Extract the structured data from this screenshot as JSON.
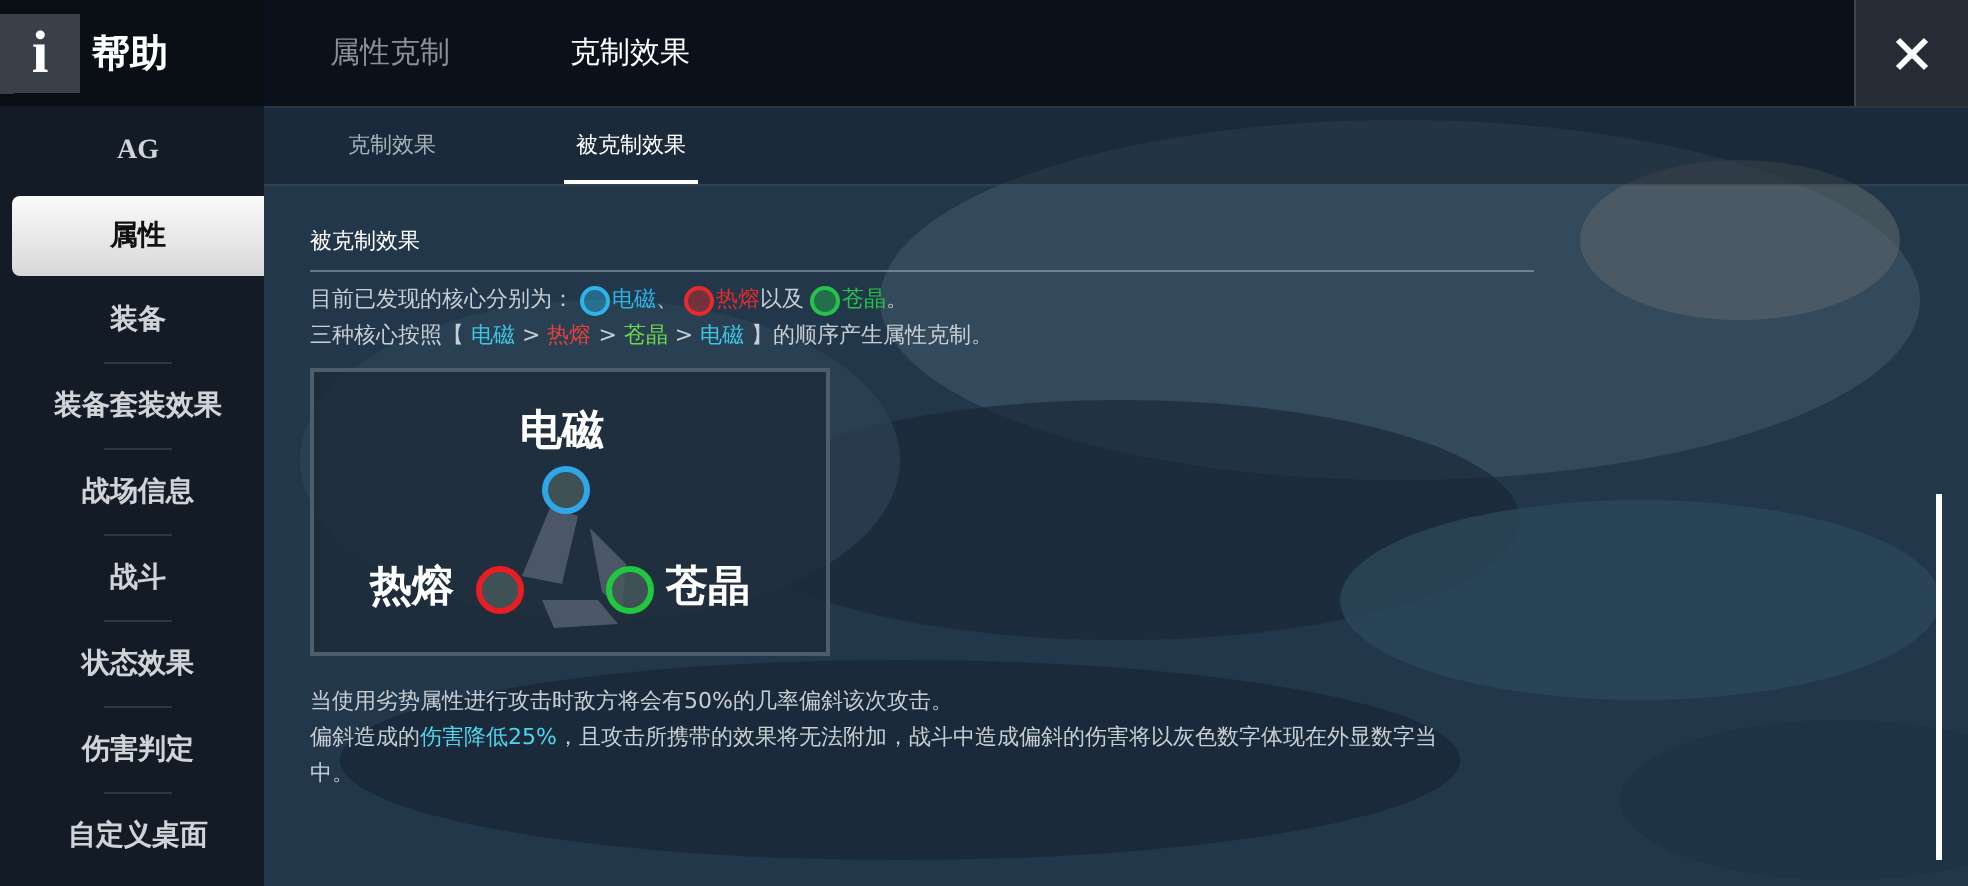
{
  "header": {
    "badge": "i",
    "title": "帮助"
  },
  "sidebar": {
    "items": [
      {
        "label": "AG",
        "selected": false
      },
      {
        "label": "属性",
        "selected": true
      },
      {
        "label": "装备",
        "selected": false
      },
      {
        "label": "装备套装效果",
        "selected": false
      },
      {
        "label": "战场信息",
        "selected": false
      },
      {
        "label": "战斗",
        "selected": false
      },
      {
        "label": "状态效果",
        "selected": false
      },
      {
        "label": "伤害判定",
        "selected": false
      },
      {
        "label": "自定义桌面",
        "selected": false
      }
    ]
  },
  "tabs": [
    {
      "label": "属性克制",
      "selected": false
    },
    {
      "label": "克制效果",
      "selected": true
    }
  ],
  "subtabs": [
    {
      "label": "克制效果",
      "selected": false
    },
    {
      "label": "被克制效果",
      "selected": true
    }
  ],
  "section": {
    "title": "被克制效果",
    "intro": [
      [
        {
          "kind": "text",
          "text": "目前已发现的核心分别为："
        },
        {
          "kind": "core",
          "text": "电磁",
          "color": "#2fb4e8"
        },
        {
          "kind": "text",
          "text": "、"
        },
        {
          "kind": "core",
          "text": "热熔",
          "color": "#e82a2a"
        },
        {
          "kind": "text",
          "text": "以及"
        },
        {
          "kind": "core",
          "text": "苍晶",
          "color": "#26c24a"
        },
        {
          "kind": "text",
          "text": "。"
        }
      ],
      [
        {
          "text": "三种核心按照【 "
        },
        {
          "text": "电磁",
          "color": "#3ec6e6"
        },
        {
          "text": " > "
        },
        {
          "text": "热熔",
          "color": "#e8413a"
        },
        {
          "text": " > "
        },
        {
          "text": "苍晶",
          "color": "#6fd84a"
        },
        {
          "text": " > "
        },
        {
          "text": "电磁",
          "color": "#3ec6e6"
        },
        {
          "text": " 】的顺序产生属性克制。"
        }
      ]
    ],
    "diagram": [
      {
        "label": "电磁",
        "color": "#2fa6e6"
      },
      {
        "label": "热熔",
        "color": "#e81e24"
      },
      {
        "label": "苍晶",
        "color": "#1fc840"
      }
    ],
    "notes": [
      [
        {
          "text": "当使用劣势属性进行攻击时敌方将会有50%的几率偏斜该次攻击。"
        }
      ],
      [
        {
          "text": "偏斜造成的"
        },
        {
          "text": "伤害降低25%",
          "color": "#4fd6ec"
        },
        {
          "text": "，且攻击所携带的效果将无法附加，战斗中造成偏斜的伤害将以灰色数字体现在外显数字当中。"
        }
      ]
    ]
  }
}
